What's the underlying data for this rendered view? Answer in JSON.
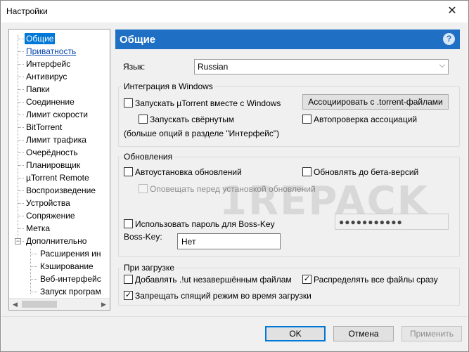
{
  "window": {
    "title": "Настройки",
    "close_glyph": "✕"
  },
  "tree": {
    "items": [
      {
        "label": "Общие",
        "state": "selected"
      },
      {
        "label": "Приватность",
        "state": "link"
      },
      {
        "label": "Интерфейс"
      },
      {
        "label": "Антивирус"
      },
      {
        "label": "Папки"
      },
      {
        "label": "Соединение"
      },
      {
        "label": "Лимит скорости"
      },
      {
        "label": "BitTorrent"
      },
      {
        "label": "Лимит трафика"
      },
      {
        "label": "Очерёдность"
      },
      {
        "label": "Планировщик"
      },
      {
        "label": "µTorrent Remote"
      },
      {
        "label": "Воспроизведение"
      },
      {
        "label": "Устройства"
      },
      {
        "label": "Сопряжение"
      },
      {
        "label": "Метка"
      },
      {
        "label": "Дополнительно",
        "expander": "−"
      },
      {
        "label": "Расширения ин"
      },
      {
        "label": "Кэширование"
      },
      {
        "label": "Веб-интерфейс"
      },
      {
        "label": "Запуск програм"
      }
    ],
    "scroll_left": "◀",
    "scroll_right": "▶"
  },
  "panel": {
    "title": "Общие",
    "help_glyph": "?",
    "language_label": "Язык:",
    "language_value": "Russian",
    "language_chevron": "⌵"
  },
  "integration": {
    "title": "Интеграция в Windows",
    "start_with_windows": {
      "label": "Запускать µTorrent вместе с Windows",
      "checked": false
    },
    "start_minimized": {
      "label": "Запускать свёрнутым",
      "checked": false
    },
    "more_options_note": "(больше опций в разделе \"Интерфейс\")",
    "associate_button": "Ассоциировать с .torrent-файлами",
    "auto_check_assoc": {
      "label": "Автопроверка ассоциаций",
      "checked": false
    }
  },
  "updates": {
    "title": "Обновления",
    "auto_install": {
      "label": "Автоустановка обновлений",
      "checked": false
    },
    "beta_updates": {
      "label": "Обновлять до бета-версий",
      "checked": false
    },
    "notify_before": {
      "label": "Оповещать перед установкой обновлений",
      "checked": false
    }
  },
  "bosskey": {
    "use_password": {
      "label": "Использовать пароль для Boss-Key",
      "checked": false
    },
    "password_mask": "●●●●●●●●●●●",
    "bosskey_label": "Boss-Key:",
    "bosskey_value": "Нет"
  },
  "on_download": {
    "title": "При загрузке",
    "append_ut": {
      "label": "Добавлять .!ut незавершённым файлам",
      "checked": false
    },
    "preallocate": {
      "label": "Распределять все файлы сразу",
      "checked": true
    },
    "prevent_sleep": {
      "label": "Запрещать спящий режим во время загрузки",
      "checked": true
    }
  },
  "watermark": "1REPACK",
  "footer": {
    "ok": "OK",
    "cancel": "Отмена",
    "apply": "Применить"
  },
  "check_glyph": "✓"
}
